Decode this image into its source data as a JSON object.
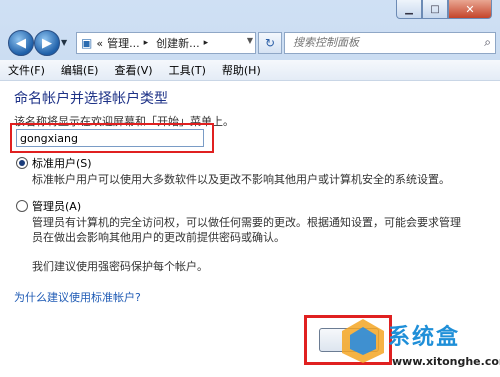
{
  "window": {
    "min_icon": "minimize-icon",
    "max_icon": "maximize-icon",
    "close_icon": "close-icon"
  },
  "nav": {
    "address_icon": "control-panel-icon",
    "address_parts": [
      "«",
      "管理...",
      "▸",
      "创建新...",
      "▸"
    ],
    "search_placeholder": "搜索控制面板"
  },
  "menu": [
    "文件(F)",
    "编辑(E)",
    "查看(V)",
    "工具(T)",
    "帮助(H)"
  ],
  "main": {
    "heading": "命名帐户并选择帐户类型",
    "description": "该名称将显示在欢迎屏幕和「开始」菜单上。",
    "account_name": "gongxiang",
    "options": [
      {
        "label": "标准用户(S)",
        "selected": true,
        "description": "标准帐户用户可以使用大多数软件以及更改不影响其他用户或计算机安全的系统设置。"
      },
      {
        "label": "管理员(A)",
        "selected": false,
        "description_line1": "管理员有计算机的完全访问权，可以做任何需要的更改。根据通知设置，可能会要求管理",
        "description_line2": "员在做出会影响其他用户的更改前提供密码或确认。"
      }
    ],
    "recommendation": "我们建议使用强密码保护每个帐户。",
    "help_link": "为什么建议使用标准帐户?",
    "next_button": ""
  },
  "watermark": {
    "brand": "系统盒",
    "url": "www.xitonghe.com"
  },
  "colors": {
    "heading": "#1e3287",
    "link": "#1f5bb5",
    "highlight": "#e02020"
  }
}
